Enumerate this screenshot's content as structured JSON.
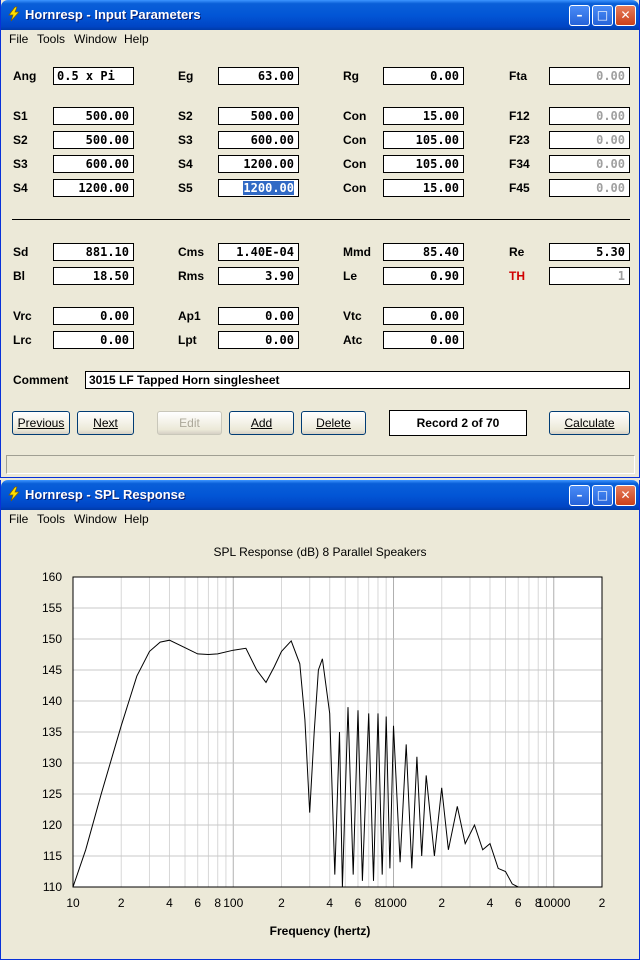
{
  "win1": {
    "title": "Hornresp - Input Parameters",
    "menu": [
      "File",
      "Tools",
      "Window",
      "Help"
    ],
    "row0": [
      {
        "label": "Ang",
        "value": "0.5 x Pi"
      },
      {
        "label": "Eg",
        "value": "63.00"
      },
      {
        "label": "Rg",
        "value": "0.00"
      },
      {
        "label": "Fta",
        "value": "0.00"
      }
    ],
    "rows": [
      [
        {
          "label": "S1",
          "value": "500.00"
        },
        {
          "label": "S2",
          "value": "500.00"
        },
        {
          "label": "Con",
          "value": "15.00"
        },
        {
          "label": "F12",
          "value": "0.00"
        }
      ],
      [
        {
          "label": "S2",
          "value": "500.00"
        },
        {
          "label": "S3",
          "value": "600.00"
        },
        {
          "label": "Con",
          "value": "105.00"
        },
        {
          "label": "F23",
          "value": "0.00"
        }
      ],
      [
        {
          "label": "S3",
          "value": "600.00"
        },
        {
          "label": "S4",
          "value": "1200.00"
        },
        {
          "label": "Con",
          "value": "105.00"
        },
        {
          "label": "F34",
          "value": "0.00"
        }
      ],
      [
        {
          "label": "S4",
          "value": "1200.00"
        },
        {
          "label": "S5",
          "value": "1200.00"
        },
        {
          "label": "Con",
          "value": "15.00"
        },
        {
          "label": "F45",
          "value": "0.00"
        }
      ]
    ],
    "driver": [
      [
        {
          "label": "Sd",
          "value": "881.10"
        },
        {
          "label": "Cms",
          "value": "1.40E-04"
        },
        {
          "label": "Mmd",
          "value": "85.40"
        },
        {
          "label": "Re",
          "value": "5.30"
        }
      ],
      [
        {
          "label": "Bl",
          "value": "18.50"
        },
        {
          "label": "Rms",
          "value": "3.90"
        },
        {
          "label": "Le",
          "value": "0.90"
        },
        {
          "label": "TH",
          "value": "1"
        }
      ]
    ],
    "chambers": [
      [
        {
          "label": "Vrc",
          "value": "0.00"
        },
        {
          "label": "Ap1",
          "value": "0.00"
        },
        {
          "label": "Vtc",
          "value": "0.00"
        }
      ],
      [
        {
          "label": "Lrc",
          "value": "0.00"
        },
        {
          "label": "Lpt",
          "value": "0.00"
        },
        {
          "label": "Atc",
          "value": "0.00"
        }
      ]
    ],
    "comment_label": "Comment",
    "comment_value": "3015 LF Tapped Horn singlesheet",
    "buttons": {
      "previous": "Previous",
      "next": "Next",
      "edit": "Edit",
      "add": "Add",
      "delete": "Delete",
      "calculate": "Calculate"
    },
    "record": "Record 2 of 70",
    "th_color": "#d00000"
  },
  "win2": {
    "title": "Hornresp - SPL Response",
    "menu": [
      "File",
      "Tools",
      "Window",
      "Help"
    ]
  },
  "chart_data": {
    "type": "line",
    "title": "SPL Response (dB)   8 Parallel Speakers",
    "xlabel": "Frequency (hertz)",
    "ylabel": "",
    "x_scale": "log",
    "xlim": [
      10,
      20000
    ],
    "ylim": [
      110,
      160
    ],
    "grid": true,
    "x_tick_labels": [
      "10",
      "2",
      "4",
      "6",
      "8",
      "100",
      "2",
      "4",
      "6",
      "8",
      "1000",
      "2",
      "4",
      "6",
      "8",
      "10000",
      "2"
    ],
    "y_tick_labels": [
      "160",
      "155",
      "150",
      "145",
      "140",
      "135",
      "130",
      "125",
      "120",
      "115",
      "110"
    ],
    "series": [
      {
        "x": [
          10,
          12,
          15,
          20,
          25,
          30,
          35,
          40,
          50,
          60,
          70,
          80,
          100,
          120,
          140,
          160,
          180,
          200,
          230,
          260,
          280,
          300,
          320,
          340,
          360,
          400,
          430,
          460,
          480,
          520,
          560,
          600,
          640,
          700,
          750,
          800,
          850,
          900,
          950,
          1000,
          1100,
          1200,
          1300,
          1400,
          1500,
          1600,
          1800,
          2000,
          2200,
          2500,
          2800,
          3200,
          3600,
          4000,
          4500,
          5000,
          5500,
          6000
        ],
        "y": [
          110,
          116,
          125,
          136,
          144,
          148,
          149.5,
          149.8,
          148.6,
          147.6,
          147.5,
          147.6,
          148.2,
          148.5,
          145,
          143,
          145.5,
          148,
          149.7,
          146,
          137,
          122,
          135,
          145,
          146.8,
          138,
          112,
          135,
          110,
          139,
          112,
          138.5,
          111,
          138,
          111,
          138,
          112,
          137.5,
          113,
          136,
          114,
          133,
          113,
          131,
          115,
          128,
          115,
          126,
          116,
          123,
          117,
          120,
          116,
          117,
          113,
          112.5,
          110.5,
          110
        ]
      }
    ]
  }
}
